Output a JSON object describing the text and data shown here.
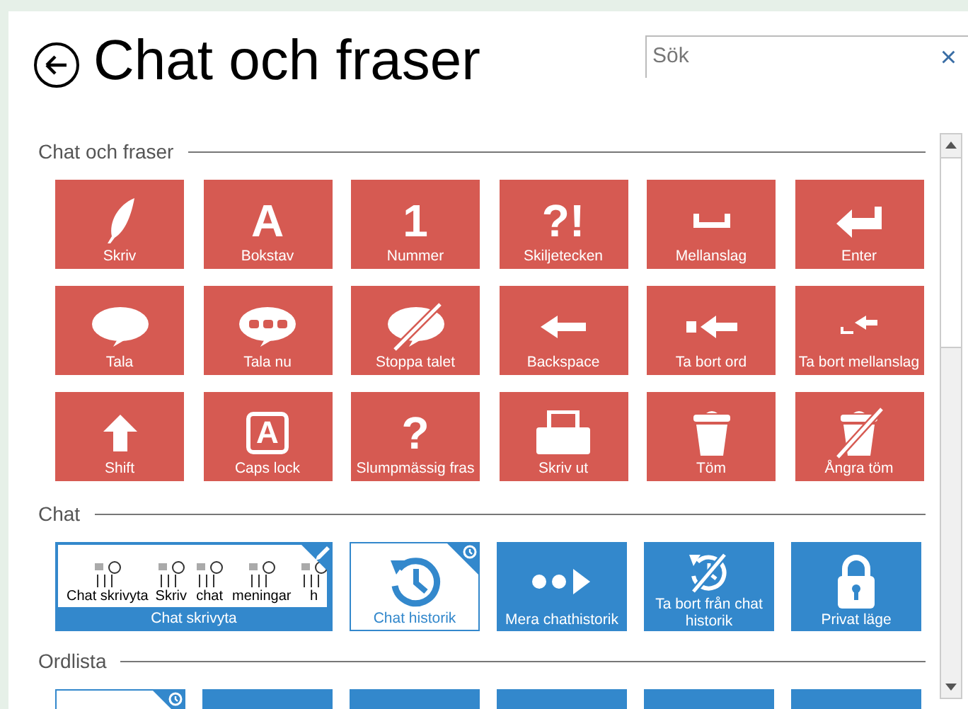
{
  "header": {
    "title": "Chat och fraser",
    "search": {
      "placeholder": "Sök",
      "clear": "×"
    }
  },
  "sections": [
    {
      "title": "Chat och fraser",
      "tiles": [
        {
          "label": "Skriv"
        },
        {
          "label": "Bokstav",
          "glyph": "A"
        },
        {
          "label": "Nummer",
          "glyph": "1"
        },
        {
          "label": "Skiljetecken",
          "glyph": "?!"
        },
        {
          "label": "Mellanslag"
        },
        {
          "label": "Enter"
        },
        {
          "label": "Tala"
        },
        {
          "label": "Tala nu"
        },
        {
          "label": "Stoppa talet"
        },
        {
          "label": "Backspace"
        },
        {
          "label": "Ta bort ord"
        },
        {
          "label": "Ta bort mellanslag"
        },
        {
          "label": "Shift"
        },
        {
          "label": "Caps lock",
          "glyph": "A"
        },
        {
          "label": "Slumpmässig fras",
          "glyph": "?"
        },
        {
          "label": "Skriv ut"
        },
        {
          "label": "Töm"
        },
        {
          "label": "Ångra töm"
        }
      ]
    },
    {
      "title": "Chat",
      "tiles": [
        {
          "kind": "preview",
          "label": "Chat skrivyta",
          "words": [
            "Chat skrivyta",
            "Skriv",
            "chat",
            "meningar",
            "h"
          ]
        },
        {
          "kind": "outline",
          "label": "Chat historik"
        },
        {
          "kind": "solid",
          "label": "Mera chathistorik"
        },
        {
          "kind": "solid",
          "label": "Ta bort från chat historik"
        },
        {
          "kind": "solid",
          "label": "Privat läge"
        }
      ]
    },
    {
      "title": "Ordlista",
      "tiles": [
        {
          "kind": "outline"
        },
        {
          "kind": "solid"
        },
        {
          "kind": "solid"
        },
        {
          "kind": "solid"
        },
        {
          "kind": "solid"
        },
        {
          "kind": "solid"
        }
      ]
    }
  ]
}
